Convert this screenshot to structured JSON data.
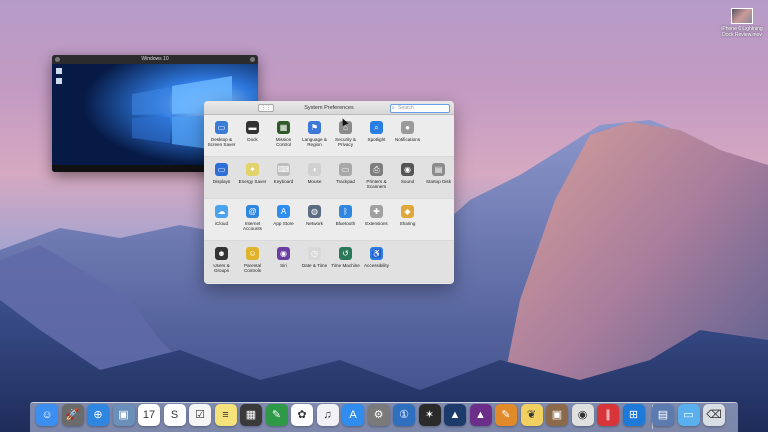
{
  "desktop": {
    "file_label": "iPhone 6 Lightning Dock Review.mov"
  },
  "vm_window": {
    "title": "Windows 10"
  },
  "sys_prefs": {
    "title": "System Preferences",
    "search_placeholder": "Search",
    "grid_button": "⋮⋮",
    "rows": [
      [
        {
          "label": "Desktop & Screen Saver",
          "icon": "desktop-icon",
          "color": "#3a7bd5",
          "glyph": "▭"
        },
        {
          "label": "Dock",
          "icon": "dock-icon",
          "color": "#333333",
          "glyph": "▬"
        },
        {
          "label": "Mission Control",
          "icon": "mission-control-icon",
          "color": "#2d5a27",
          "glyph": "▦"
        },
        {
          "label": "Language & Region",
          "icon": "flag-icon",
          "color": "#3b78d8",
          "glyph": "⚑"
        },
        {
          "label": "Security & Privacy",
          "icon": "house-lock-icon",
          "color": "#8a8a8a",
          "glyph": "⌂"
        },
        {
          "label": "Spotlight",
          "icon": "magnifier-icon",
          "color": "#2a7de1",
          "glyph": "⌕"
        },
        {
          "label": "Notifications",
          "icon": "notifications-icon",
          "color": "#9a9a9a",
          "glyph": "●"
        }
      ],
      [
        {
          "label": "Displays",
          "icon": "display-icon",
          "color": "#2d6fd6",
          "glyph": "▭"
        },
        {
          "label": "Energy Saver",
          "icon": "lightbulb-icon",
          "color": "#e2d36b",
          "glyph": "✦"
        },
        {
          "label": "Keyboard",
          "icon": "keyboard-icon",
          "color": "#bdbdbd",
          "glyph": "⌨"
        },
        {
          "label": "Mouse",
          "icon": "mouse-icon",
          "color": "#d0d0d0",
          "glyph": "◖"
        },
        {
          "label": "Trackpad",
          "icon": "trackpad-icon",
          "color": "#a8a8a8",
          "glyph": "▭"
        },
        {
          "label": "Printers & Scanners",
          "icon": "printer-icon",
          "color": "#7e7e7e",
          "glyph": "⎙"
        },
        {
          "label": "Sound",
          "icon": "speaker-icon",
          "color": "#555555",
          "glyph": "◉"
        },
        {
          "label": "Startup Disk",
          "icon": "disk-icon",
          "color": "#8c8c8c",
          "glyph": "▤"
        }
      ],
      [
        {
          "label": "iCloud",
          "icon": "cloud-icon",
          "color": "#4aa3ee",
          "glyph": "☁"
        },
        {
          "label": "Internet Accounts",
          "icon": "at-icon",
          "color": "#2e86de",
          "glyph": "@"
        },
        {
          "label": "App Store",
          "icon": "app-store-icon",
          "color": "#2f8df0",
          "glyph": "A"
        },
        {
          "label": "Network",
          "icon": "globe-icon",
          "color": "#5b6b82",
          "glyph": "◍"
        },
        {
          "label": "Bluetooth",
          "icon": "bluetooth-icon",
          "color": "#2f86e0",
          "glyph": "ᛒ"
        },
        {
          "label": "Extensions",
          "icon": "puzzle-icon",
          "color": "#a0a0a0",
          "glyph": "✚"
        },
        {
          "label": "Sharing",
          "icon": "sharing-icon",
          "color": "#e0a83a",
          "glyph": "◆"
        }
      ],
      [
        {
          "label": "Users & Groups",
          "icon": "users-icon",
          "color": "#333333",
          "glyph": "☻"
        },
        {
          "label": "Parental Controls",
          "icon": "parental-icon",
          "color": "#e0b32a",
          "glyph": "☺"
        },
        {
          "label": "Siri",
          "icon": "siri-icon",
          "color": "#6b3fa0",
          "glyph": "◉"
        },
        {
          "label": "Date & Time",
          "icon": "clock-icon",
          "color": "#d9d9d9",
          "glyph": "◷"
        },
        {
          "label": "Time Machine",
          "icon": "time-machine-icon",
          "color": "#2a7a5a",
          "glyph": "↺"
        },
        {
          "label": "Accessibility",
          "icon": "accessibility-icon",
          "color": "#2d7de0",
          "glyph": "♿"
        }
      ]
    ]
  },
  "dock": {
    "items": [
      {
        "name": "finder-icon",
        "color": "#3c8ff0",
        "glyph": "☺"
      },
      {
        "name": "launchpad-icon",
        "color": "#6b6b6b",
        "glyph": "🚀"
      },
      {
        "name": "safari-icon",
        "color": "#2f86e0",
        "glyph": "⊕"
      },
      {
        "name": "preview-icon",
        "color": "#6a8fb8",
        "glyph": "▣"
      },
      {
        "name": "calendar-icon",
        "color": "#ffffff",
        "glyph": "17"
      },
      {
        "name": "sketchbook-icon",
        "color": "#ffffff",
        "glyph": "S"
      },
      {
        "name": "reminders-icon",
        "color": "#f5f5f5",
        "glyph": "☑"
      },
      {
        "name": "notes-icon",
        "color": "#f6e27a",
        "glyph": "≡"
      },
      {
        "name": "calculator-icon",
        "color": "#3a3a3a",
        "glyph": "▦"
      },
      {
        "name": "evernote-icon",
        "color": "#2e9a48",
        "glyph": "✎"
      },
      {
        "name": "photos-icon",
        "color": "#ffffff",
        "glyph": "✿"
      },
      {
        "name": "itunes-icon",
        "color": "#f0f0f5",
        "glyph": "♫"
      },
      {
        "name": "app-store-icon",
        "color": "#2f8df0",
        "glyph": "A"
      },
      {
        "name": "system-preferences-icon",
        "color": "#7a7a7a",
        "glyph": "⚙"
      },
      {
        "name": "1password-icon",
        "color": "#2f6fbf",
        "glyph": "①"
      },
      {
        "name": "final-cut-icon",
        "color": "#2a2a2a",
        "glyph": "✶"
      },
      {
        "name": "affinity-designer-icon",
        "color": "#1c3b6b",
        "glyph": "▲"
      },
      {
        "name": "affinity-photo-icon",
        "color": "#6b2f8a",
        "glyph": "▲"
      },
      {
        "name": "pixelmator-icon",
        "color": "#e08a2a",
        "glyph": "✎"
      },
      {
        "name": "tes-butterfly-icon",
        "color": "#f0d060",
        "glyph": "❦"
      },
      {
        "name": "box-icon",
        "color": "#8a6a4a",
        "glyph": "▣"
      },
      {
        "name": "screenflow-icon",
        "color": "#e0e0e0",
        "glyph": "◉"
      },
      {
        "name": "parallels-icon",
        "color": "#d8353a",
        "glyph": "∥"
      },
      {
        "name": "windows-10-icon",
        "color": "#1e7ad8",
        "glyph": "⊞"
      },
      {
        "name": "image-stack-icon",
        "color": "#5a7ab0",
        "glyph": "▤"
      },
      {
        "name": "folder-icon",
        "color": "#5ab0ee",
        "glyph": "▭"
      },
      {
        "name": "trash-icon",
        "color": "#d9dde4",
        "glyph": "⌫"
      }
    ]
  }
}
